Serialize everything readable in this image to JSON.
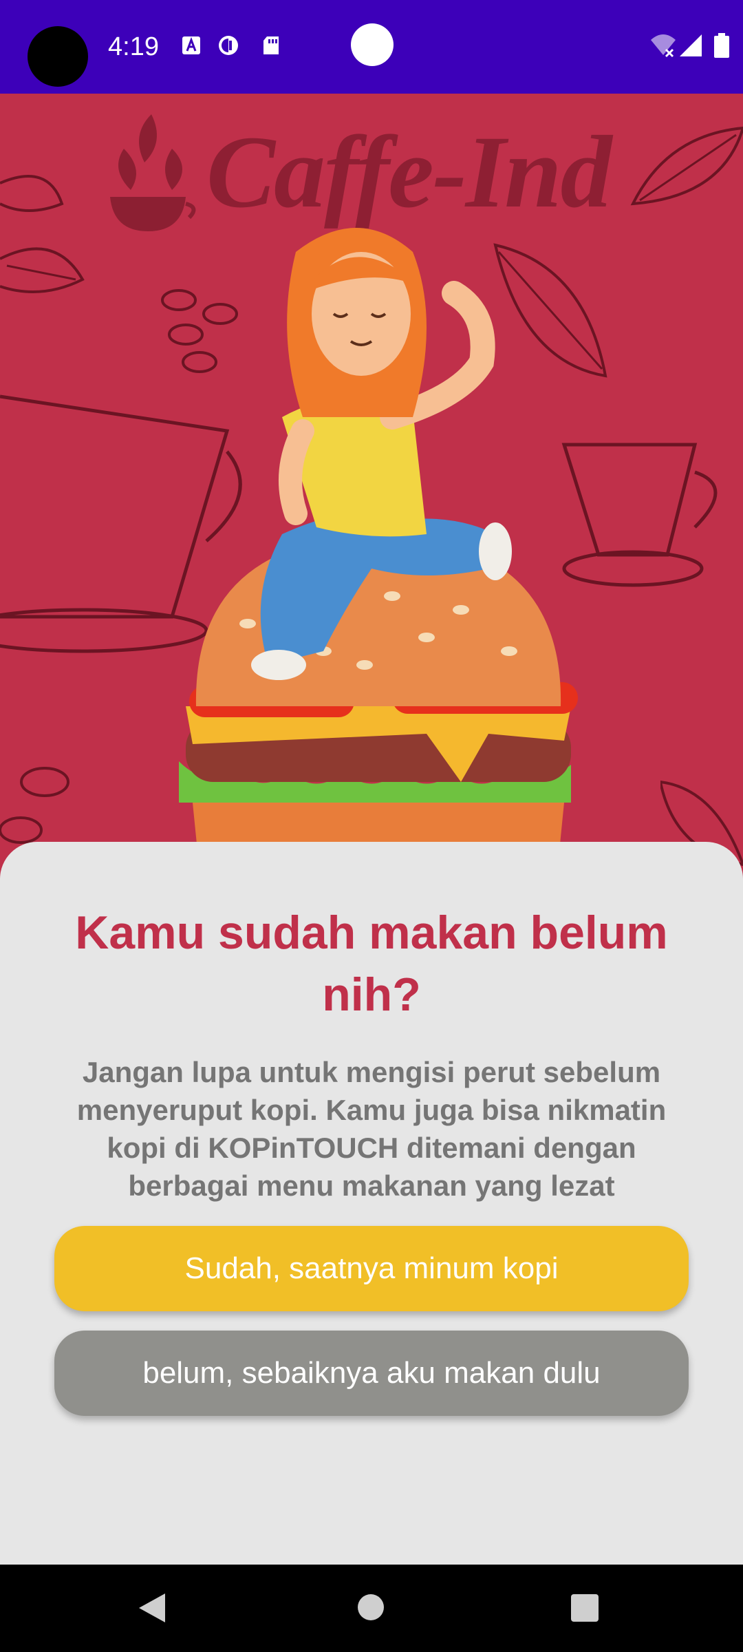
{
  "status_bar": {
    "time": "4:19",
    "icons": [
      "a-notification-icon",
      "c-notification-icon",
      "sd-card-icon",
      "wifi-icon",
      "signal-icon",
      "battery-icon"
    ]
  },
  "hero": {
    "brand": "Caffe-Ind",
    "illustration": "girl-sitting-on-burger",
    "background_color": "#c0304a"
  },
  "content": {
    "title": "Kamu sudah makan belum nih?",
    "description": "Jangan lupa untuk mengisi perut sebelum menyeruput kopi. Kamu juga bisa nikmatin kopi di KOPinTOUCH ditemani dengan berbagai menu makanan yang lezat"
  },
  "buttons": {
    "yes_label": "Sudah, saatnya minum kopi",
    "no_label": "belum, sebaiknya aku makan dulu"
  },
  "colors": {
    "status_bar": "#3d00b9",
    "accent": "#c0304a",
    "yes_button": "#f1bf27",
    "no_button": "#90908c"
  },
  "nav_bar": {
    "icons": [
      "back-icon",
      "home-icon",
      "recents-icon"
    ]
  }
}
